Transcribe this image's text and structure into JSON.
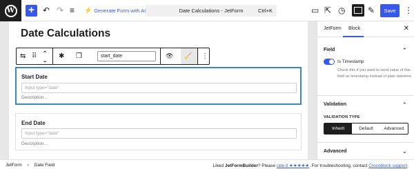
{
  "toolbar": {
    "add_symbol": "+",
    "undo_symbol": "↶",
    "redo_symbol": "↷",
    "list_view_symbol": "≡",
    "generate_form_label": "Generate Form with AI",
    "document_title": "Date Calculations - JetForm",
    "shortcut": "Ctrl+K",
    "view_symbol": "▭",
    "external_symbol": "⇱",
    "history_symbol": "◷",
    "style_symbol": "✎",
    "save_label": "Save",
    "more_symbol": "⋮"
  },
  "editor": {
    "page_title": "Date Calculations",
    "block_toolbar": {
      "field_name_value": "start_date",
      "icons": {
        "transform": "⇆",
        "drag": "⠿",
        "move": "⌃",
        "asterisk": "✱",
        "copy": "❐",
        "eye": "👁",
        "brush": "🧹",
        "options": "⋮"
      }
    },
    "fields": [
      {
        "label": "Start Date",
        "placeholder": "Input type=\"date\"",
        "description": "Description..."
      },
      {
        "label": "End Date",
        "placeholder": "Input type=\"date\"",
        "description": "Description..."
      }
    ]
  },
  "sidebar": {
    "tabs": [
      "JetForm",
      "Block"
    ],
    "active_tab": "Block",
    "close_symbol": "✕",
    "field_section": {
      "title": "Field",
      "toggle_label": "Is Timestamp",
      "toggle_on": true,
      "toggle_help": "Check this if you want to send value of this field as timestamp instead of plain datetime"
    },
    "validation_section": {
      "title": "Validation",
      "type_label": "VALIDATION TYPE",
      "options": [
        "Inherit",
        "Default",
        "Advanced"
      ],
      "selected": "Inherit"
    },
    "advanced_section": {
      "title": "Advanced"
    },
    "chevron_up": "⌃",
    "chevron_down": "⌄"
  },
  "footer": {
    "breadcrumbs": [
      "JetForm",
      "Date Field"
    ],
    "crumb_sep": "›",
    "liked": "Liked ",
    "product": "JetFormBuilder",
    "please": "? Please ",
    "rate_link": "rate it ★★★★★",
    "trouble": ". For troubleshooting, contact ",
    "support_link": "Crocoblock support",
    "end": "."
  },
  "colors": {
    "accent": "#3858e9",
    "selection": "#3a86c8",
    "dark": "#1e1e1e",
    "canvas_bg": "#e7e7e7"
  }
}
